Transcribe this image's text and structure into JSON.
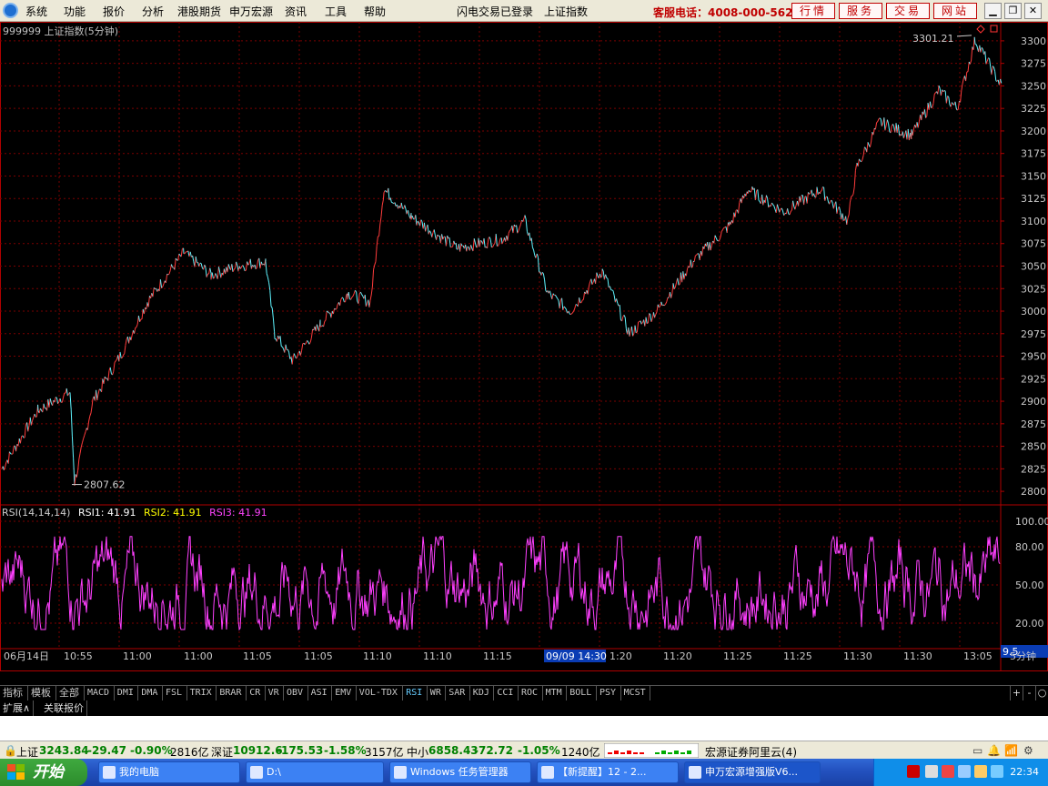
{
  "menu": {
    "items": [
      "系统",
      "功能",
      "报价",
      "分析",
      "港股期货",
      "申万宏源",
      "资讯",
      "工具",
      "帮助"
    ],
    "status": "闪电交易已登录",
    "index_name": "上证指数",
    "hotline": "客服电话：4008-000-562",
    "red_buttons": [
      "行情",
      "服务",
      "交易",
      "网站"
    ]
  },
  "chart": {
    "title": "999999 上证指数(5分钟)",
    "high_label": "3301.21",
    "low_label": "2807.62",
    "price_ticks": [
      "3300",
      "3275",
      "3250",
      "3225",
      "3200",
      "3175",
      "3150",
      "3125",
      "3100",
      "3075",
      "3050",
      "3025",
      "3000",
      "2975",
      "2950",
      "2925",
      "2900",
      "2875",
      "2850",
      "2825",
      "2800"
    ],
    "rsi_ticks": [
      "100.00",
      "80.00",
      "50.00",
      "20.00"
    ],
    "rsi_current": "9.5",
    "rsi_legend": {
      "name": "RSI(14,14,14)",
      "rsi1": "RSI1: 41.91",
      "rsi2": "RSI2: 41.91",
      "rsi3": "RSI3: 41.91"
    },
    "time_labels": [
      "06月14日",
      "10:55",
      "11:00",
      "11:00",
      "11:05",
      "11:05",
      "11:10",
      "11:10",
      "11:15",
      "09/09 14:30",
      "1:20",
      "11:20",
      "11:25",
      "11:25",
      "11:30",
      "11:30",
      "13:05"
    ],
    "period": "5分钟",
    "colors": {
      "up": "#ff3c3c",
      "down": "#5ff5ff",
      "rsi": "#ff40ff",
      "grid": "#7a0000",
      "axis": "#b00000"
    }
  },
  "chart_data": {
    "type": "line",
    "title": "999999 上证指数(5分钟)",
    "ylim": [
      2790,
      3310
    ],
    "series": [
      {
        "name": "上证指数",
        "x_index": [
          0,
          40,
          75,
          80,
          100,
          130,
          160,
          200,
          230,
          260,
          290,
          300,
          320,
          350,
          380,
          405,
          420,
          450,
          500,
          550,
          575,
          600,
          625,
          660,
          690,
          720,
          760,
          800,
          820,
          860,
          900,
          930,
          940,
          965,
          1000,
          1030,
          1050,
          1070,
          1100
        ],
        "values": [
          2825,
          2890,
          2910,
          2810,
          2900,
          2950,
          3010,
          3065,
          3040,
          3050,
          3055,
          2975,
          2945,
          2985,
          3020,
          3010,
          3135,
          3105,
          3070,
          3080,
          3100,
          3020,
          3000,
          3045,
          2975,
          3000,
          3055,
          3095,
          3135,
          3110,
          3135,
          3100,
          3160,
          3210,
          3195,
          3245,
          3225,
          3301,
          3248
        ]
      }
    ],
    "rsi": {
      "name": "RSI(14,14,14)",
      "values": [
        41.91,
        41.91,
        41.91
      ],
      "ylim": [
        0,
        100
      ]
    }
  },
  "tabs": [
    "指标",
    "模板",
    "全部",
    "MACD",
    "DMI",
    "DMA",
    "FSL",
    "TRIX",
    "BRAR",
    "CR",
    "VR",
    "OBV",
    "ASI",
    "EMV",
    "VOL-TDX",
    "RSI",
    "WR",
    "SAR",
    "KDJ",
    "CCI",
    "ROC",
    "MTM",
    "BOLL",
    "PSY",
    "MCST"
  ],
  "tab_active": "RSI",
  "ctrl_buttons": [
    "+",
    "-",
    "○"
  ],
  "ext_tabs": [
    "扩展∧",
    "关联报价"
  ],
  "ticker": {
    "sh_label": "上证",
    "sh_value": "3243.84",
    "sh_change": "-29.47",
    "sh_pct": "-0.90%",
    "sh_amount": "2816亿",
    "sz_label": "深证",
    "sz_value": "10912.6",
    "sz_change": "-175.53",
    "sz_pct": "-1.58%",
    "sz_amount": "3157亿",
    "zx_label": "中小",
    "zx_value": "6858.43",
    "zx_change": "-72.72",
    "zx_pct": "-1.05%",
    "zx_amount": "1240亿",
    "server": "宏源证券阿里云(4)"
  },
  "taskbar": {
    "start": "开始",
    "tasks": [
      "我的电脑",
      "D:\\",
      "Windows 任务管理器",
      "【新提醒】12 - 2...",
      "申万宏源增强版V6..."
    ],
    "clock": "22:34"
  }
}
